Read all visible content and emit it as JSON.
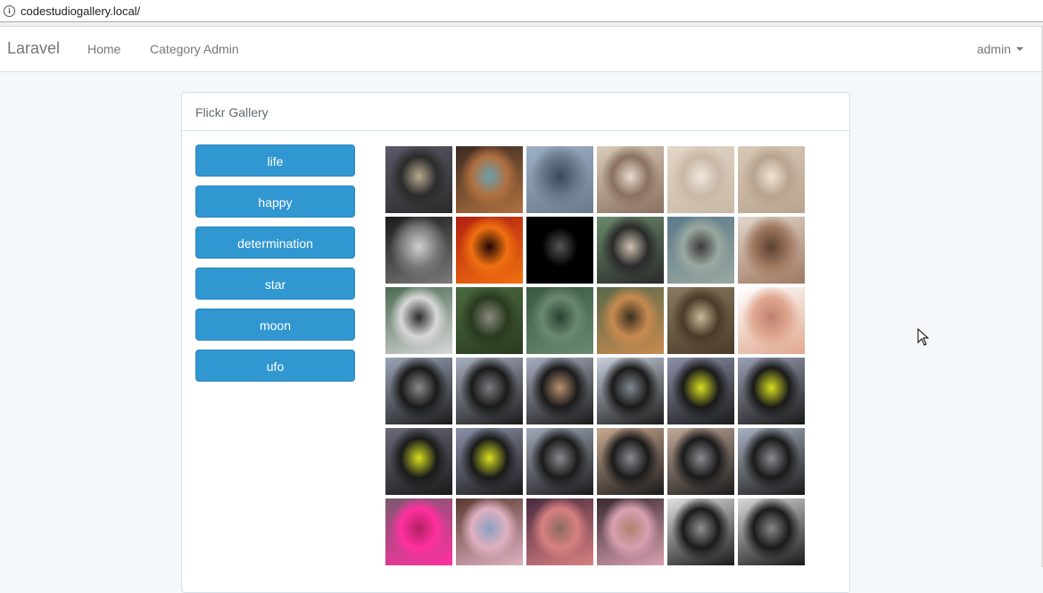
{
  "browser": {
    "url": "codestudiogallery.local/"
  },
  "navbar": {
    "brand": "Laravel",
    "links": [
      "Home",
      "Category Admin"
    ],
    "user": "admin"
  },
  "panel": {
    "title": "Flickr Gallery",
    "buttons": [
      "life",
      "happy",
      "determination",
      "star",
      "moon",
      "ufo"
    ]
  },
  "gallery": {
    "thumbnails": [
      {
        "label": "woman-city-portrait",
        "colors": [
          "#5a5a6a",
          "#2b2b2b",
          "#b8a98f"
        ]
      },
      {
        "label": "face-collage",
        "colors": [
          "#3a2a20",
          "#b07040",
          "#6aa0b0"
        ]
      },
      {
        "label": "pavilion-lake",
        "colors": [
          "#9db0c8",
          "#6b7a8a",
          "#3a4a5a"
        ]
      },
      {
        "label": "kitten-hand",
        "colors": [
          "#d9cbb8",
          "#8a7060",
          "#e8dccc"
        ]
      },
      {
        "label": "white-kitten",
        "colors": [
          "#e2d6c6",
          "#c9b8a6",
          "#f0e8de"
        ]
      },
      {
        "label": "kitten-sleeping",
        "colors": [
          "#d8c8b6",
          "#b8a48e",
          "#efe4d6"
        ]
      },
      {
        "label": "comic-art",
        "colors": [
          "#1a1a1a",
          "#7a7a7a",
          "#d0d0d0"
        ]
      },
      {
        "label": "fiery-sunset",
        "colors": [
          "#b02010",
          "#f07010",
          "#200808"
        ]
      },
      {
        "label": "black-text-quote",
        "colors": [
          "#000000",
          "#000000",
          "#555555"
        ]
      },
      {
        "label": "woman-patterned-top",
        "colors": [
          "#6a8a6a",
          "#2a2a2a",
          "#d0c0b0"
        ]
      },
      {
        "label": "woman-sitting-dock",
        "colors": [
          "#5a7a8a",
          "#9aa8a0",
          "#3a3a3a"
        ]
      },
      {
        "label": "woman-face-portrait",
        "colors": [
          "#e0d6cc",
          "#a07860",
          "#5a4030"
        ]
      },
      {
        "label": "woman-lake-portrait",
        "colors": [
          "#4a6a50",
          "#d8d8d8",
          "#2a2a2a"
        ]
      },
      {
        "label": "woman-forest-path",
        "colors": [
          "#4a6a40",
          "#2a3a20",
          "#8a8a7a"
        ]
      },
      {
        "label": "woman-lake-back",
        "colors": [
          "#3a5a40",
          "#6a8a70",
          "#2a4030"
        ]
      },
      {
        "label": "man-pizza",
        "colors": [
          "#5a6a4a",
          "#c88a50",
          "#3a3020"
        ]
      },
      {
        "label": "alpaca-face",
        "colors": [
          "#8a7a60",
          "#4a3a28",
          "#c8b898"
        ]
      },
      {
        "label": "hands-circle",
        "colors": [
          "#ffffff",
          "#e0a890",
          "#c08070"
        ]
      },
      {
        "label": "model-1",
        "colors": [
          "#9aa4b8",
          "#1a1a1a",
          "#8a8a8a"
        ]
      },
      {
        "label": "model-2",
        "colors": [
          "#a8b0c0",
          "#1a1a1a",
          "#7a7a80"
        ]
      },
      {
        "label": "model-3",
        "colors": [
          "#a8aec0",
          "#1a1a1a",
          "#b89070"
        ]
      },
      {
        "label": "model-4",
        "colors": [
          "#c8d0dc",
          "#1a1a1a",
          "#808890"
        ]
      },
      {
        "label": "model-yellow-1",
        "colors": [
          "#8a90a8",
          "#1a1a1a",
          "#d8e020"
        ]
      },
      {
        "label": "model-yellow-2",
        "colors": [
          "#9aa0b4",
          "#1a1a1a",
          "#d8e020"
        ]
      },
      {
        "label": "model-yellow-3",
        "colors": [
          "#6a6a7a",
          "#1a1a1a",
          "#d8e020"
        ]
      },
      {
        "label": "model-yellow-4",
        "colors": [
          "#8a90a8",
          "#1a1a1a",
          "#d8e020"
        ]
      },
      {
        "label": "model-5",
        "colors": [
          "#a0a8b8",
          "#1a1a1a",
          "#8a8a90"
        ]
      },
      {
        "label": "model-6",
        "colors": [
          "#c8a890",
          "#1a1a1a",
          "#8a8a90"
        ]
      },
      {
        "label": "model-7",
        "colors": [
          "#c0a898",
          "#1a1a1a",
          "#8a8a90"
        ]
      },
      {
        "label": "model-8",
        "colors": [
          "#a8b0c0",
          "#1a1a1a",
          "#8a8a90"
        ]
      },
      {
        "label": "pink-tutu",
        "colors": [
          "#7a5a70",
          "#ff30a0",
          "#b02060"
        ]
      },
      {
        "label": "denim-jacket-1",
        "colors": [
          "#5a3a30",
          "#e0b0c0",
          "#8aa0c0"
        ]
      },
      {
        "label": "denim-jacket-2",
        "colors": [
          "#4a2a40",
          "#d88080",
          "#8a6a60"
        ]
      },
      {
        "label": "denim-jacket-3",
        "colors": [
          "#3a2a30",
          "#d8a0b0",
          "#b08070"
        ]
      },
      {
        "label": "black-dress-1",
        "colors": [
          "#e0e0e0",
          "#1a1a1a",
          "#909090"
        ]
      },
      {
        "label": "black-dress-2",
        "colors": [
          "#d8d8d8",
          "#1a1a1a",
          "#888888"
        ]
      }
    ]
  }
}
